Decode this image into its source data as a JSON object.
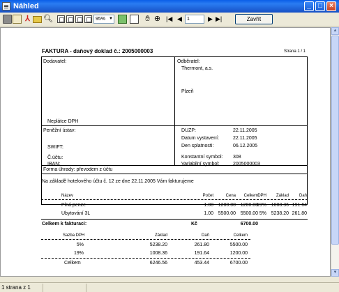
{
  "window": {
    "title": "Náhled"
  },
  "toolbar": {
    "zoom": "95%",
    "page_number": "1",
    "close_label": "Zavřít"
  },
  "status": {
    "pages": "1 strana z 1"
  },
  "invoice": {
    "title": "FAKTURA - daňový doklad   č.: 2005000003",
    "page_label": "Strana 1 / 1",
    "supplier": {
      "heading": "Dodavatel:",
      "vat_status": "Neplátce DPH"
    },
    "customer": {
      "heading": "Odběratel:",
      "name": "Thermont, a.s.",
      "city": "Plzeň"
    },
    "bank": {
      "heading": "Peněžní ústav:",
      "swift": "SWIFT:",
      "account": "Č.účtu:",
      "iban": "IBAN:"
    },
    "dates": [
      {
        "label": "DUZP:",
        "value": "22.11.2005"
      },
      {
        "label": "Datum vystavení:",
        "value": "22.11.2005"
      },
      {
        "label": "Den splatnosti:",
        "value": "06.12.2005"
      },
      {
        "label": "Konstantní symbol:",
        "value": "308"
      },
      {
        "label": "Variabilní symbol:",
        "value": "2005000003"
      }
    ],
    "payment": "Forma úhrady:  převodem z účtu",
    "note": "Na základě hotelového účtu č. 12  ze dne 22.11.2005  Vám  fakturujeme",
    "items_header": {
      "name": "Název",
      "qty": "Počet",
      "price": "Cena",
      "total": "Celkem",
      "vat": "DPH",
      "base": "Základ",
      "tax": "Daň"
    },
    "items": [
      {
        "name": "Plná penze",
        "qty": "1.00",
        "price": "1200.00",
        "total": "1200.00",
        "vat": "19%",
        "base": "1008.36",
        "tax": "191.64"
      },
      {
        "name": "Ubytování 3L",
        "qty": "1.00",
        "price": "5500.00",
        "total": "5500.00",
        "vat": "5%",
        "base": "5238.20",
        "tax": "261.80"
      }
    ],
    "grand_total": {
      "label": "Celkem k fakturaci:",
      "currency": "Kč",
      "value": "6700.00"
    },
    "vat_header": {
      "rate": "Sazba DPH",
      "base": "Základ",
      "tax": "Daň",
      "total": "Celkem"
    },
    "vat_rows": [
      {
        "rate": "5%",
        "base": "5238.20",
        "tax": "261.80",
        "total": "5500.00"
      },
      {
        "rate": "19%",
        "base": "1008.36",
        "tax": "191.64",
        "total": "1200.00"
      }
    ],
    "vat_total": {
      "label": "Celkem",
      "base": "6246.56",
      "tax": "453.44",
      "total": "6700.00"
    }
  }
}
